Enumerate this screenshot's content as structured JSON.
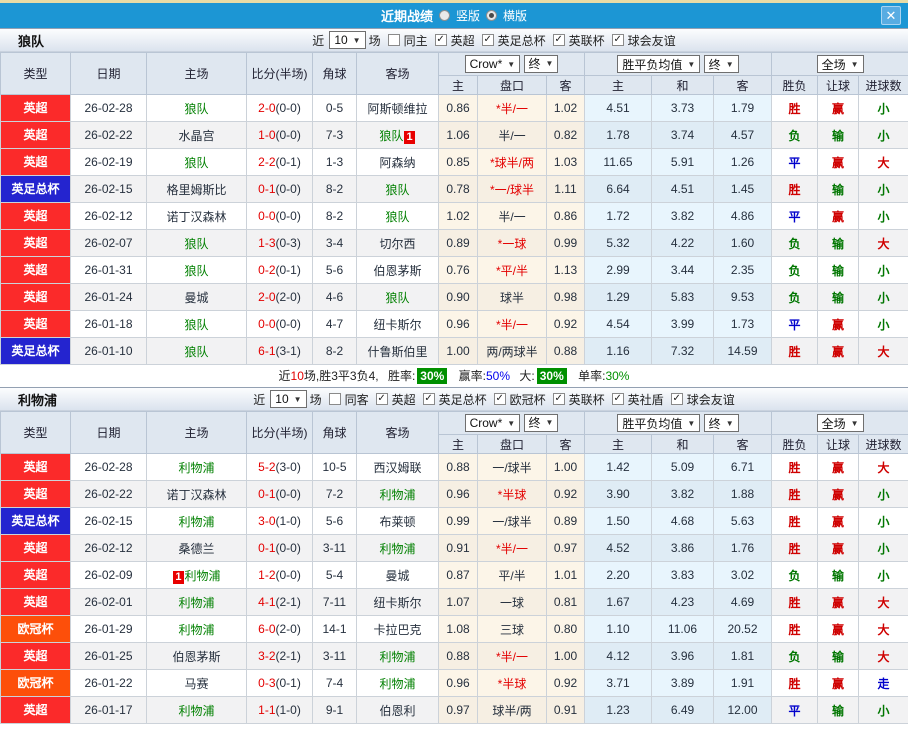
{
  "titlebar": {
    "title": "近期战绩",
    "vertical_label": "竖版",
    "horizontal_label": "横版",
    "vertical_checked": false,
    "horizontal_checked": true
  },
  "icons": {
    "close": "✕",
    "check": "✓",
    "select_arrow": "▼"
  },
  "colors": {
    "titlebar_blue": "#1c96d4",
    "league_epl_red": "#fb2a2a",
    "league_facup_blue": "#2424cf",
    "league_ucl_orange": "#fd4f0a",
    "focus_team_green": "#008000",
    "win_red": "#cf0000",
    "draw_blue": "#0000cc",
    "loss_green": "#007600",
    "rate_badge_green": "#009000"
  },
  "table_header": {
    "type": "类型",
    "date": "日期",
    "home": "主场",
    "score": "比分(半场)",
    "corner": "角球",
    "away": "客场",
    "odds_company": "Crow*",
    "final1": "终",
    "mean": "胜平负均值",
    "final2": "终",
    "full": "全场",
    "h_home": "主",
    "h_handicap": "盘口",
    "h_away": "客",
    "m_home": "主",
    "m_draw": "和",
    "m_away": "客",
    "r_result": "胜负",
    "r_handicap": "让球",
    "r_goals": "进球数"
  },
  "sections": [
    {
      "team": "狼队",
      "filter": {
        "near_label": "近",
        "count": "10",
        "games_label": "场",
        "venue": {
          "label": "同主",
          "checked": false
        },
        "leagues": [
          {
            "label": "英超",
            "checked": true
          },
          {
            "label": "英足总杯",
            "checked": true
          },
          {
            "label": "英联杯",
            "checked": true
          },
          {
            "label": "球会友谊",
            "checked": true
          }
        ]
      },
      "rows": [
        {
          "league": "英超",
          "date": "26-02-28",
          "home": {
            "name": "狼队"
          },
          "score": "2-0",
          "half": "(0-0)",
          "corner": "0-5",
          "away": {
            "name": "阿斯顿维拉"
          },
          "o1": "0.86",
          "hc": "*半/一",
          "o2": "1.02",
          "m1": "4.51",
          "m2": "3.73",
          "m3": "1.79",
          "res": "胜",
          "sp": "赢",
          "gl": "小"
        },
        {
          "league": "英超",
          "date": "26-02-22",
          "home": {
            "name": "水晶宫"
          },
          "score": "1-0",
          "half": "(0-0)",
          "corner": "7-3",
          "away": {
            "name": "狼队",
            "badge_post": "1"
          },
          "o1": "1.06",
          "hc": "半/一",
          "o2": "0.82",
          "m1": "1.78",
          "m2": "3.74",
          "m3": "4.57",
          "res": "负",
          "sp": "输",
          "gl": "小"
        },
        {
          "league": "英超",
          "date": "26-02-19",
          "home": {
            "name": "狼队"
          },
          "score": "2-2",
          "half": "(0-1)",
          "corner": "1-3",
          "away": {
            "name": "阿森纳"
          },
          "o1": "0.85",
          "hc": "*球半/两",
          "o2": "1.03",
          "m1": "11.65",
          "m2": "5.91",
          "m3": "1.26",
          "res": "平",
          "sp": "赢",
          "gl": "大"
        },
        {
          "league": "英足总杯",
          "date": "26-02-15",
          "home": {
            "name": "格里姆斯比"
          },
          "score": "0-1",
          "half": "(0-0)",
          "corner": "8-2",
          "away": {
            "name": "狼队"
          },
          "o1": "0.78",
          "hc": "*一/球半",
          "o2": "1.11",
          "m1": "6.64",
          "m2": "4.51",
          "m3": "1.45",
          "res": "胜",
          "sp": "输",
          "gl": "小"
        },
        {
          "league": "英超",
          "date": "26-02-12",
          "home": {
            "name": "诺丁汉森林"
          },
          "score": "0-0",
          "half": "(0-0)",
          "corner": "8-2",
          "away": {
            "name": "狼队"
          },
          "o1": "1.02",
          "hc": "半/一",
          "o2": "0.86",
          "m1": "1.72",
          "m2": "3.82",
          "m3": "4.86",
          "res": "平",
          "sp": "赢",
          "gl": "小"
        },
        {
          "league": "英超",
          "date": "26-02-07",
          "home": {
            "name": "狼队"
          },
          "score": "1-3",
          "half": "(0-3)",
          "corner": "3-4",
          "away": {
            "name": "切尔西"
          },
          "o1": "0.89",
          "hc": "*一球",
          "o2": "0.99",
          "m1": "5.32",
          "m2": "4.22",
          "m3": "1.60",
          "res": "负",
          "sp": "输",
          "gl": "大"
        },
        {
          "league": "英超",
          "date": "26-01-31",
          "home": {
            "name": "狼队"
          },
          "score": "0-2",
          "half": "(0-1)",
          "corner": "5-6",
          "away": {
            "name": "伯恩茅斯"
          },
          "o1": "0.76",
          "hc": "*平/半",
          "o2": "1.13",
          "m1": "2.99",
          "m2": "3.44",
          "m3": "2.35",
          "res": "负",
          "sp": "输",
          "gl": "小"
        },
        {
          "league": "英超",
          "date": "26-01-24",
          "home": {
            "name": "曼城"
          },
          "score": "2-0",
          "half": "(2-0)",
          "corner": "4-6",
          "away": {
            "name": "狼队"
          },
          "o1": "0.90",
          "hc": "球半",
          "o2": "0.98",
          "m1": "1.29",
          "m2": "5.83",
          "m3": "9.53",
          "res": "负",
          "sp": "输",
          "gl": "小"
        },
        {
          "league": "英超",
          "date": "26-01-18",
          "home": {
            "name": "狼队"
          },
          "score": "0-0",
          "half": "(0-0)",
          "corner": "4-7",
          "away": {
            "name": "纽卡斯尔"
          },
          "o1": "0.96",
          "hc": "*半/一",
          "o2": "0.92",
          "m1": "4.54",
          "m2": "3.99",
          "m3": "1.73",
          "res": "平",
          "sp": "赢",
          "gl": "小"
        },
        {
          "league": "英足总杯",
          "date": "26-01-10",
          "home": {
            "name": "狼队"
          },
          "score": "6-1",
          "half": "(3-1)",
          "corner": "8-2",
          "away": {
            "name": "什鲁斯伯里"
          },
          "o1": "1.00",
          "hc": "两/两球半",
          "o2": "0.88",
          "m1": "1.16",
          "m2": "7.32",
          "m3": "14.59",
          "res": "胜",
          "sp": "赢",
          "gl": "大"
        }
      ],
      "summary": {
        "near": "近",
        "count": "10",
        "mid": "场,胜3平3负4,",
        "win_label": "胜率:",
        "win_value": "30%",
        "spread_label": "赢率:",
        "spread_value": "50%",
        "big_label": "大:",
        "big_value": "30%",
        "single_label": "单率:",
        "single_value": "30%"
      }
    },
    {
      "team": "利物浦",
      "filter": {
        "near_label": "近",
        "count": "10",
        "games_label": "场",
        "venue": {
          "label": "同客",
          "checked": false
        },
        "leagues": [
          {
            "label": "英超",
            "checked": true
          },
          {
            "label": "英足总杯",
            "checked": true
          },
          {
            "label": "欧冠杯",
            "checked": true
          },
          {
            "label": "英联杯",
            "checked": true
          },
          {
            "label": "英社盾",
            "checked": true
          },
          {
            "label": "球会友谊",
            "checked": true
          }
        ]
      },
      "rows": [
        {
          "league": "英超",
          "date": "26-02-28",
          "home": {
            "name": "利物浦"
          },
          "score": "5-2",
          "half": "(3-0)",
          "corner": "10-5",
          "away": {
            "name": "西汉姆联"
          },
          "o1": "0.88",
          "hc": "一/球半",
          "o2": "1.00",
          "m1": "1.42",
          "m2": "5.09",
          "m3": "6.71",
          "res": "胜",
          "sp": "赢",
          "gl": "大"
        },
        {
          "league": "英超",
          "date": "26-02-22",
          "home": {
            "name": "诺丁汉森林"
          },
          "score": "0-1",
          "half": "(0-0)",
          "corner": "7-2",
          "away": {
            "name": "利物浦"
          },
          "o1": "0.96",
          "hc": "*半球",
          "o2": "0.92",
          "m1": "3.90",
          "m2": "3.82",
          "m3": "1.88",
          "res": "胜",
          "sp": "赢",
          "gl": "小"
        },
        {
          "league": "英足总杯",
          "date": "26-02-15",
          "home": {
            "name": "利物浦"
          },
          "score": "3-0",
          "half": "(1-0)",
          "corner": "5-6",
          "away": {
            "name": "布莱顿"
          },
          "o1": "0.99",
          "hc": "一/球半",
          "o2": "0.89",
          "m1": "1.50",
          "m2": "4.68",
          "m3": "5.63",
          "res": "胜",
          "sp": "赢",
          "gl": "小"
        },
        {
          "league": "英超",
          "date": "26-02-12",
          "home": {
            "name": "桑德兰"
          },
          "score": "0-1",
          "half": "(0-0)",
          "corner": "3-11",
          "away": {
            "name": "利物浦"
          },
          "o1": "0.91",
          "hc": "*半/一",
          "o2": "0.97",
          "m1": "4.52",
          "m2": "3.86",
          "m3": "1.76",
          "res": "胜",
          "sp": "赢",
          "gl": "小"
        },
        {
          "league": "英超",
          "date": "26-02-09",
          "home": {
            "name": "利物浦",
            "badge_pre": "1"
          },
          "score": "1-2",
          "half": "(0-0)",
          "corner": "5-4",
          "away": {
            "name": "曼城"
          },
          "o1": "0.87",
          "hc": "平/半",
          "o2": "1.01",
          "m1": "2.20",
          "m2": "3.83",
          "m3": "3.02",
          "res": "负",
          "sp": "输",
          "gl": "小"
        },
        {
          "league": "英超",
          "date": "26-02-01",
          "home": {
            "name": "利物浦"
          },
          "score": "4-1",
          "half": "(2-1)",
          "corner": "7-11",
          "away": {
            "name": "纽卡斯尔"
          },
          "o1": "1.07",
          "hc": "一球",
          "o2": "0.81",
          "m1": "1.67",
          "m2": "4.23",
          "m3": "4.69",
          "res": "胜",
          "sp": "赢",
          "gl": "大"
        },
        {
          "league": "欧冠杯",
          "date": "26-01-29",
          "home": {
            "name": "利物浦"
          },
          "score": "6-0",
          "half": "(2-0)",
          "corner": "14-1",
          "away": {
            "name": "卡拉巴克"
          },
          "o1": "1.08",
          "hc": "三球",
          "o2": "0.80",
          "m1": "1.10",
          "m2": "11.06",
          "m3": "20.52",
          "res": "胜",
          "sp": "赢",
          "gl": "大"
        },
        {
          "league": "英超",
          "date": "26-01-25",
          "home": {
            "name": "伯恩茅斯"
          },
          "score": "3-2",
          "half": "(2-1)",
          "corner": "3-11",
          "away": {
            "name": "利物浦"
          },
          "o1": "0.88",
          "hc": "*半/一",
          "o2": "1.00",
          "m1": "4.12",
          "m2": "3.96",
          "m3": "1.81",
          "res": "负",
          "sp": "输",
          "gl": "大"
        },
        {
          "league": "欧冠杯",
          "date": "26-01-22",
          "home": {
            "name": "马赛"
          },
          "score": "0-3",
          "half": "(0-1)",
          "corner": "7-4",
          "away": {
            "name": "利物浦"
          },
          "o1": "0.96",
          "hc": "*半球",
          "o2": "0.92",
          "m1": "3.71",
          "m2": "3.89",
          "m3": "1.91",
          "res": "胜",
          "sp": "赢",
          "gl": "走"
        },
        {
          "league": "英超",
          "date": "26-01-17",
          "home": {
            "name": "利物浦"
          },
          "score": "1-1",
          "half": "(1-0)",
          "corner": "9-1",
          "away": {
            "name": "伯恩利"
          },
          "o1": "0.97",
          "hc": "球半/两",
          "o2": "0.91",
          "m1": "1.23",
          "m2": "6.49",
          "m3": "12.00",
          "res": "平",
          "sp": "输",
          "gl": "小"
        }
      ]
    }
  ]
}
